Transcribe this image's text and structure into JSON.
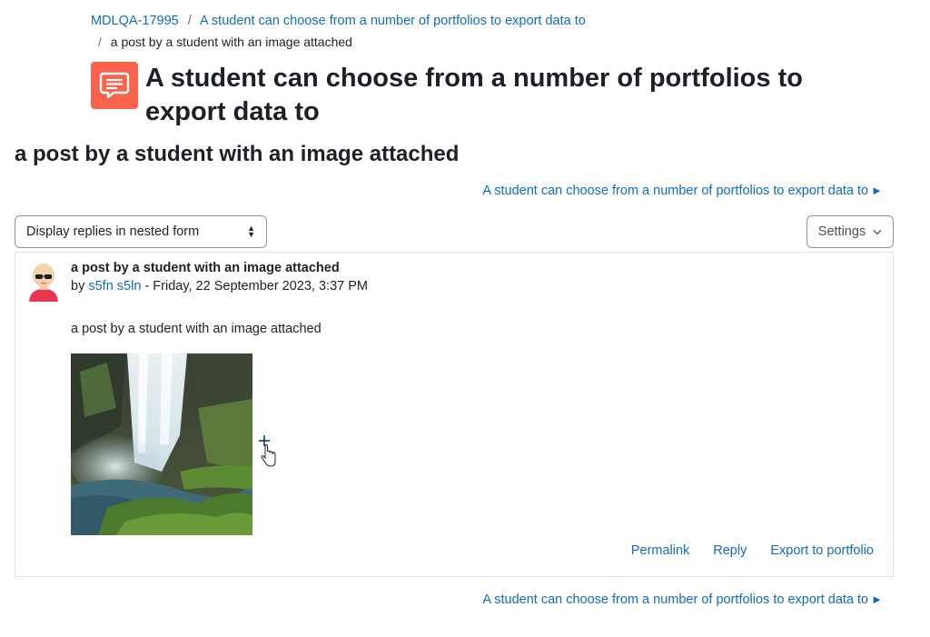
{
  "breadcrumb": {
    "items": [
      "MDLQA-17995",
      "A student can choose from a number of portfolios to export data to"
    ],
    "current": "a post by a student with an image attached"
  },
  "forum": {
    "icon": "forum-chat-icon",
    "icon_color": "#f7634d",
    "title": "A student can choose from a number of portfolios to export data to"
  },
  "discussion": {
    "title": "a post by a student with an image attached"
  },
  "navigation": {
    "back_link_top": "A student can choose from a number of portfolios to export data to",
    "back_link_bottom": "A student can choose from a number of portfolios to export data to",
    "arrow_glyph": "►"
  },
  "controls": {
    "display_mode": "Display replies in nested form",
    "settings_label": "Settings"
  },
  "post": {
    "subject": "a post by a student with an image attached",
    "by_prefix": "by",
    "author": "s5fn s5ln",
    "date": "- Friday, 22 September 2023, 3:37 PM",
    "message": "a post by a student with an image attached",
    "image_alt": "waterfall",
    "actions": {
      "permalink": "Permalink",
      "reply": "Reply",
      "export": "Export to portfolio"
    }
  },
  "colors": {
    "link": "#0f6cbf",
    "text": "#1d2125",
    "border": "#dee2e6"
  }
}
